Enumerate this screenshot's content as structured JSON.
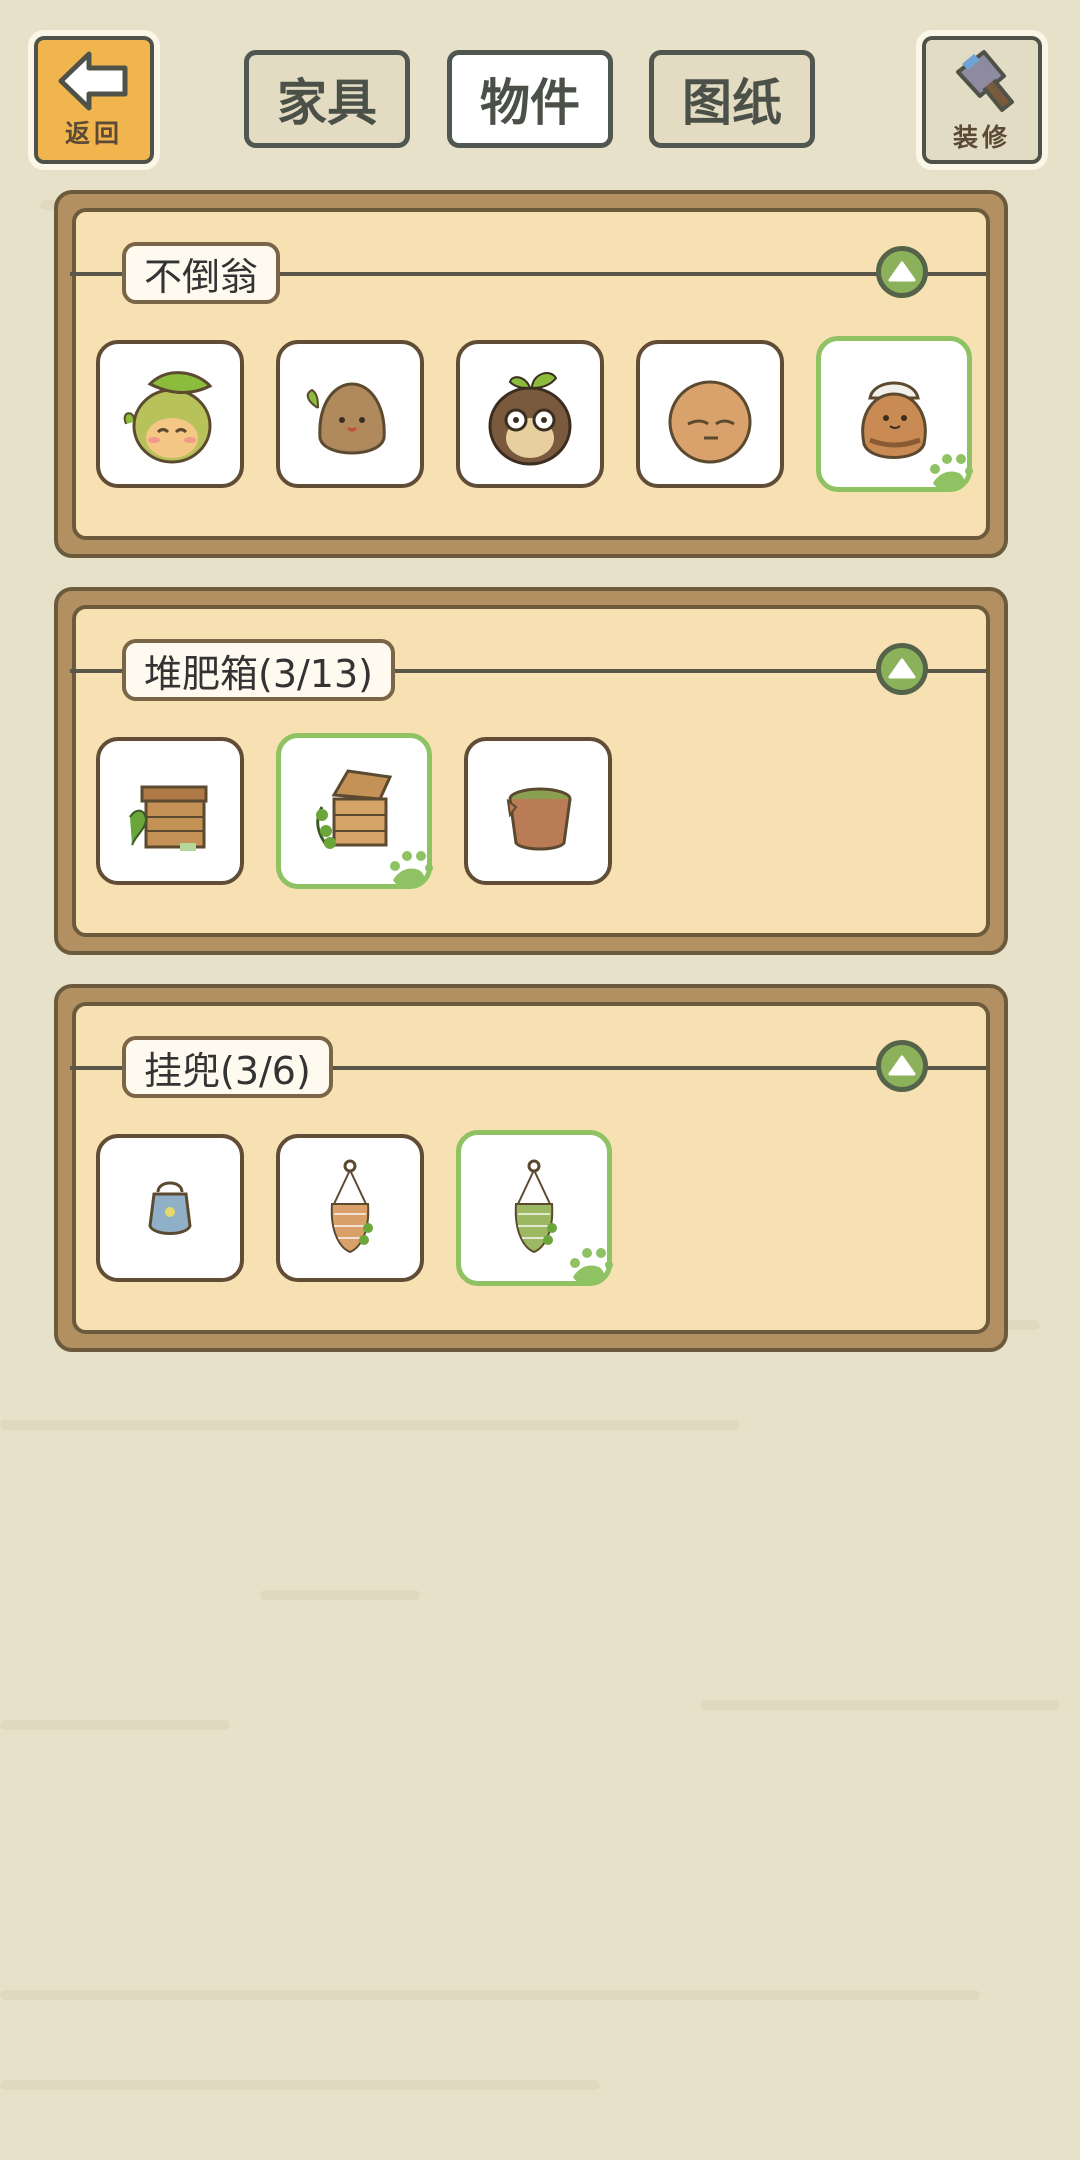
{
  "header": {
    "back_label": "返回",
    "decorate_label": "装修",
    "tabs": [
      {
        "label": "家具",
        "active": false
      },
      {
        "label": "物件",
        "active": true
      },
      {
        "label": "图纸",
        "active": false
      }
    ]
  },
  "sections": [
    {
      "title": "不倒翁",
      "items": [
        {
          "icon": "leaf-tumbler-icon",
          "selected": false
        },
        {
          "icon": "sprout-tumbler-icon",
          "selected": false
        },
        {
          "icon": "owl-tumbler-icon",
          "selected": false
        },
        {
          "icon": "sleepy-tumbler-icon",
          "selected": false
        },
        {
          "icon": "cat-tumbler-icon",
          "selected": true
        }
      ]
    },
    {
      "title": "堆肥箱(3/13)",
      "items": [
        {
          "icon": "wooden-compost-box-icon",
          "selected": false
        },
        {
          "icon": "open-compost-box-icon",
          "selected": true
        },
        {
          "icon": "bucket-compost-icon",
          "selected": false
        }
      ]
    },
    {
      "title": "挂兜(3/6)",
      "items": [
        {
          "icon": "blue-hanging-pouch-icon",
          "selected": false
        },
        {
          "icon": "orange-hanging-net-icon",
          "selected": false
        },
        {
          "icon": "green-hanging-net-icon",
          "selected": true
        }
      ]
    }
  ],
  "colors": {
    "background": "#e6e1c8",
    "panel_frame": "#b29061",
    "panel_fill": "#f7e1b3",
    "selected_border": "#8fc263",
    "back_button": "#f0b54d"
  }
}
